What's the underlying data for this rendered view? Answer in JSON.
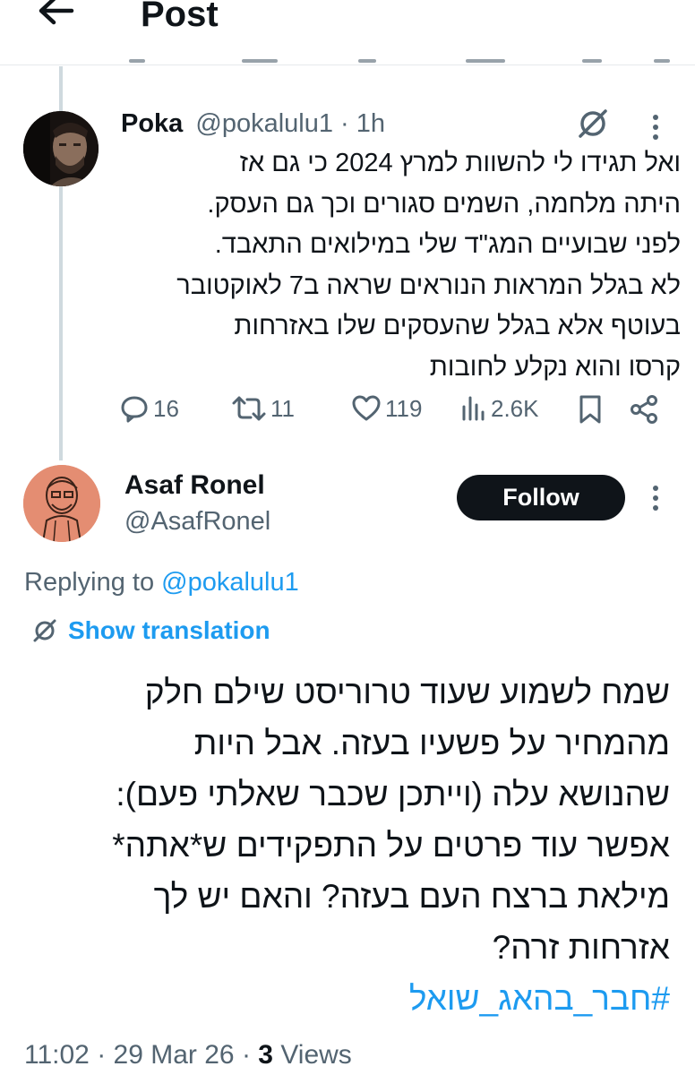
{
  "header": {
    "title": "Post",
    "back_icon": "arrow-left-icon"
  },
  "reply": {
    "display_name": "Poka",
    "handle": "@pokalulu1",
    "separator": " · ",
    "age": "1h",
    "text_lines": [
      "ואל תגידו לי להשוות למרץ 2024 כי גם אז",
      "היתה מלחמה, השמים סגורים וכך גם העסק.",
      "לפני שבועיים המג\"ד שלי במילואים התאבד.",
      "לא בגלל המראות הנוראים שראה ב7 לאוקטובר",
      "בעוטף אלא בגלל שהעסקים שלו באזרחות",
      "קרסו והוא נקלע לחובות"
    ],
    "replies": "16",
    "reposts": "11",
    "likes": "119",
    "views": "2.6K"
  },
  "post": {
    "display_name": "Asaf Ronel",
    "handle": "@AsafRonel",
    "follow_label": "Follow",
    "replying_prefix": "Replying to ",
    "replying_handle": "@pokalulu1",
    "show_translation": "Show translation",
    "text_lines": [
      "שמח לשמוע שעוד טרוריסט שילם חלק",
      "מהמחיר על פשעיו בעזה. אבל היות",
      "שהנושא עלה (וייתכן שכבר שאלתי פעם):",
      "אפשר עוד פרטים על התפקידים ש*אתה*",
      "מילאת ברצח העם בעזה? והאם יש לך",
      "אזרחות זרה?"
    ],
    "hashtag": "#חבר_בהאג_שואל",
    "time": "11:02",
    "date": "29 Mar 26",
    "views_count": "3",
    "views_label": "Views",
    "dot": " · "
  },
  "colors": {
    "link": "#1d9bf0",
    "muted": "#536471",
    "text": "#0f1419",
    "thread_line": "#cfd9de"
  }
}
